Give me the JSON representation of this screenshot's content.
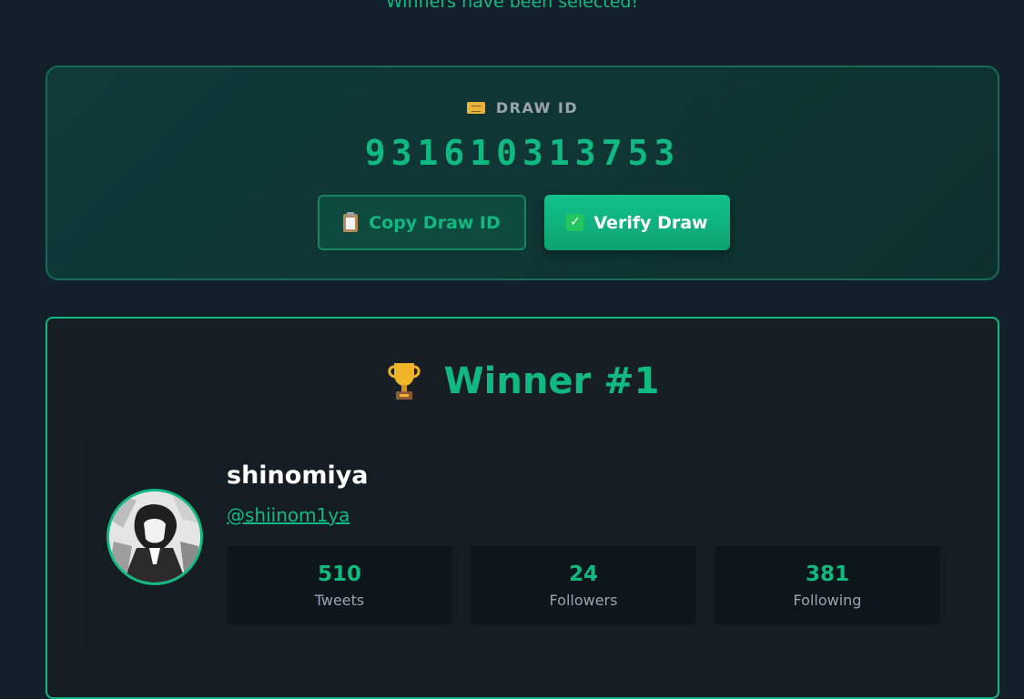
{
  "status_message": "Winners have been selected!",
  "draw": {
    "label": "DRAW ID",
    "label_icon": "ticket-icon",
    "id": "931610313753",
    "copy_button": "Copy Draw ID",
    "copy_icon": "clipboard-icon",
    "verify_button": "Verify Draw",
    "verify_icon": "check-icon"
  },
  "winner": {
    "title": "Winner #1",
    "title_icon": "trophy-icon",
    "name": "shinomiya",
    "handle": "@shiinom1ya",
    "stats": [
      {
        "value": "510",
        "label": "Tweets"
      },
      {
        "value": "24",
        "label": "Followers"
      },
      {
        "value": "381",
        "label": "Following"
      }
    ]
  },
  "colors": {
    "accent": "#10b981",
    "background": "#11202a",
    "card": "#171f25"
  }
}
